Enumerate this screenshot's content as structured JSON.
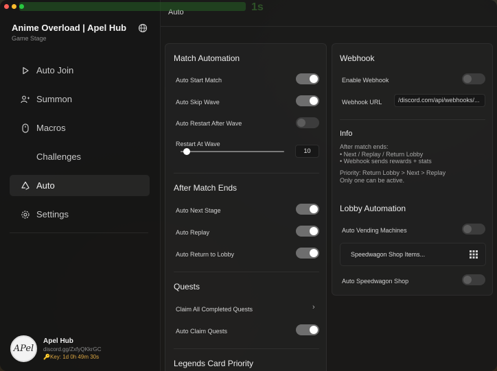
{
  "hud": {
    "time_text": "1s"
  },
  "sidebar": {
    "app_title": "Anime Overload | Apel Hub",
    "app_subtitle": "Game Stage",
    "items": [
      {
        "label": "Auto Join",
        "icon": "play-icon"
      },
      {
        "label": "Summon",
        "icon": "users-icon"
      },
      {
        "label": "Macros",
        "icon": "mouse-icon"
      },
      {
        "label": "Challenges",
        "icon": ""
      },
      {
        "label": "Auto",
        "icon": "recycle-icon",
        "active": true
      },
      {
        "label": "Settings",
        "icon": "gear-icon"
      }
    ],
    "profile": {
      "avatar_text": "APel",
      "name": "Apel Hub",
      "link": "discord.gg/ZxfyQKkrGC",
      "key": "🔑Key: 1d 0h 49m 30s"
    }
  },
  "header": {
    "title": "Auto"
  },
  "match_automation": {
    "title": "Match Automation",
    "auto_start_match": {
      "label": "Auto Start Match",
      "on": true
    },
    "auto_skip_wave": {
      "label": "Auto Skip Wave",
      "on": true
    },
    "auto_restart_after_wave": {
      "label": "Auto Restart After Wave",
      "on": false
    },
    "restart_at_wave": {
      "label": "Restart At Wave",
      "value": "10",
      "fraction": 0.06
    }
  },
  "after_match": {
    "title": "After Match Ends",
    "auto_next_stage": {
      "label": "Auto Next Stage",
      "on": true
    },
    "auto_replay": {
      "label": "Auto Replay",
      "on": true
    },
    "auto_return_lobby": {
      "label": "Auto Return to Lobby",
      "on": true
    }
  },
  "quests": {
    "title": "Quests",
    "claim_all": {
      "label": "Claim All Completed Quests"
    },
    "auto_claim": {
      "label": "Auto Claim Quests",
      "on": true
    }
  },
  "legends": {
    "title": "Legends Card Priority"
  },
  "webhook": {
    "title": "Webhook",
    "enable": {
      "label": "Enable Webhook",
      "on": false
    },
    "url": {
      "label": "Webhook URL",
      "value": "/discord.com/api/webhooks/..."
    }
  },
  "info": {
    "title": "Info",
    "text1": "After match ends:\n• Next / Replay / Return Lobby\n• Webhook sends rewards + stats",
    "text2": "Priority: Return Lobby > Next > Replay\nOnly one can be active."
  },
  "lobby": {
    "title": "Lobby Automation",
    "vending": {
      "label": "Auto Vending Machines",
      "on": false
    },
    "speedwagon_items": {
      "label": "Speedwagon Shop Items..."
    },
    "speedwagon_shop": {
      "label": "Auto Speedwagon Shop",
      "on": false
    }
  }
}
